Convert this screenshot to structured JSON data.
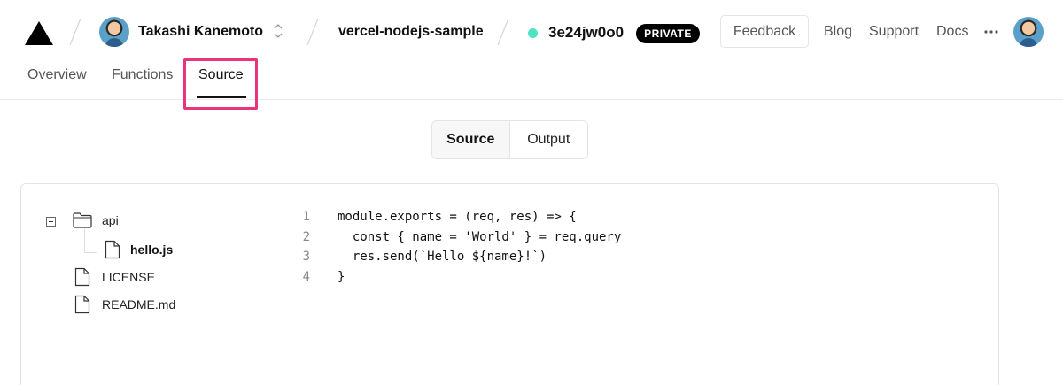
{
  "header": {
    "user_name": "Takashi Kanemoto",
    "project_name": "vercel-nodejs-sample",
    "deployment_id": "3e24jw0o0",
    "visibility_badge": "PRIVATE",
    "feedback_label": "Feedback",
    "nav_links": [
      "Blog",
      "Support",
      "Docs"
    ],
    "status_color": "#50e3c2"
  },
  "tabs": {
    "items": [
      "Overview",
      "Functions",
      "Source"
    ],
    "active": "Source",
    "highlight_color": "#e8347a"
  },
  "view_toggle": {
    "source_label": "Source",
    "output_label": "Output",
    "selected": "Source"
  },
  "file_tree": {
    "folder_name": "api",
    "folder_child": "hello.js",
    "files": [
      "LICENSE",
      "README.md"
    ],
    "selected_file": "hello.js"
  },
  "code": {
    "line_numbers": [
      "1",
      "2",
      "3",
      "4"
    ],
    "lines": [
      "module.exports = (req, res) => {",
      "  const { name = 'World' } = req.query",
      "  res.send(`Hello ${name}!`)",
      "}"
    ]
  },
  "icons": {
    "logo": "vercel-triangle-icon",
    "switcher": "chevron-updown-icon",
    "more": "more-horizontal-icon",
    "folder": "folder-icon",
    "file": "file-icon",
    "collapse": "minus-square-icon"
  }
}
